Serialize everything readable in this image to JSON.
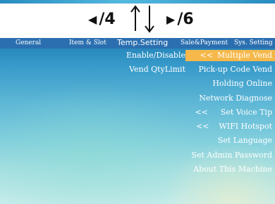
{
  "nav": {
    "left_label": "/4",
    "right_label": "/6"
  },
  "tabs": [
    {
      "label": "General"
    },
    {
      "label": "Item & Slot"
    },
    {
      "label": "Temp.Setting",
      "active": true
    },
    {
      "label": "Sale&Payment"
    },
    {
      "label": "Sys. Setting"
    }
  ],
  "left_menu": [
    {
      "label": "Enable/Disable"
    },
    {
      "label": "Vend QtyLimit"
    }
  ],
  "right_menu": [
    {
      "label": "Multiple Vend",
      "prefix": "<<",
      "selected": true
    },
    {
      "label": "Pick-up Code Vend"
    },
    {
      "label": "Holding Online"
    },
    {
      "label": "Network Diagnose"
    },
    {
      "label": "Set Voice Tip",
      "prefix": "<<"
    },
    {
      "label": "WIFI Hotspot",
      "prefix": "<<"
    },
    {
      "label": "Set Language"
    },
    {
      "label": "Set Admin Password"
    },
    {
      "label": "About This Machine"
    }
  ],
  "colors": {
    "tab_bar": "#2b6fb0",
    "highlight": "#f6b84a",
    "text": "#ffffff"
  }
}
